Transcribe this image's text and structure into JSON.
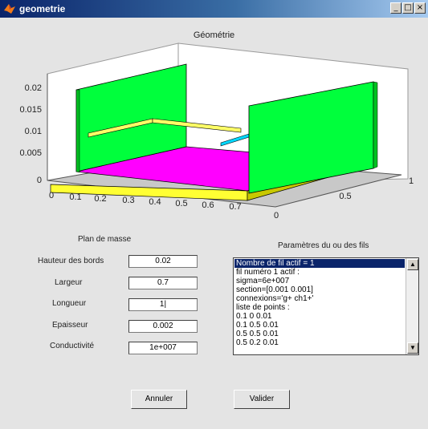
{
  "window": {
    "title": "geometrie",
    "controls": [
      "_",
      "□",
      "×"
    ]
  },
  "plot": {
    "title": "Géométrie",
    "z_ticks": [
      "0.02",
      "0.015",
      "0.01",
      "0.005",
      "0"
    ],
    "x_ticks": [
      "0",
      "0.1",
      "0.2",
      "0.3",
      "0.4",
      "0.5",
      "0.6",
      "0.7"
    ],
    "y_ticks": [
      "0",
      "0.5",
      "1"
    ],
    "colors": {
      "walls": "#00ff3c",
      "floor": "#ff00ff",
      "base_edge": "#ffff33",
      "wire": "#ffff66"
    }
  },
  "ground_plane": {
    "heading": "Plan de masse",
    "fields": [
      {
        "label": "Hauteur des bords",
        "value": "0.02"
      },
      {
        "label": "Largeur",
        "value": "0.7"
      },
      {
        "label": "Longueur",
        "value": "1|"
      },
      {
        "label": "Epaisseur",
        "value": "0.002"
      },
      {
        "label": "Conductivité",
        "value": "1e+007"
      }
    ]
  },
  "wire_params": {
    "heading": "Paramètres du ou des fils",
    "items": [
      "Nombre de fil actif = 1",
      "fil numéro 1 actif :",
      "sigma=6e+007",
      "section=[0.001 0.001]",
      "connexions='g+ ch1+'",
      "liste de points :",
      "0.1 0 0.01",
      "0.1 0.5 0.01",
      "0.5 0.5 0.01",
      "0.5 0.2 0.01"
    ],
    "selected_index": 0
  },
  "buttons": {
    "cancel": "Annuler",
    "ok": "Valider"
  }
}
